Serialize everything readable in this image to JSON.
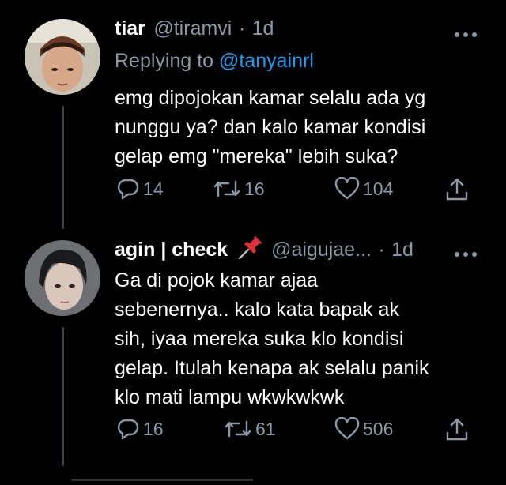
{
  "tweets": [
    {
      "name": "tiar",
      "handle": "@tiramvi",
      "separator": "·",
      "time": "1d",
      "replying_prefix": "Replying to ",
      "replying_to": "@tanyainrl",
      "lines": [
        "emg dipojokan kamar selalu ada yg",
        "nunggu ya? dan kalo kamar kondisi",
        "gelap emg \"mereka\" lebih suka?"
      ],
      "replies": "14",
      "retweets": "16",
      "likes": "104"
    },
    {
      "name": "agin | check",
      "handle": "@aigujae...",
      "separator": "·",
      "time": "1d",
      "lines": [
        "Ga di pojok kamar ajaa",
        "sebenernya.. kalo kata bapak ak",
        "sih, iyaa mereka suka klo kondisi",
        "gelap. Itulah kenapa ak selalu panik",
        "klo mati lampu wkwkwkwk"
      ],
      "replies": "16",
      "retweets": "61",
      "likes": "506"
    }
  ],
  "colors": {
    "background": "#000000",
    "text": "#ffffff",
    "muted": "#8b98a5",
    "link": "#1d9bf0",
    "thread_line": "#3d4349"
  },
  "icons": [
    "more-icon",
    "reply-icon",
    "retweet-icon",
    "like-icon",
    "share-icon",
    "pushpin-icon"
  ]
}
